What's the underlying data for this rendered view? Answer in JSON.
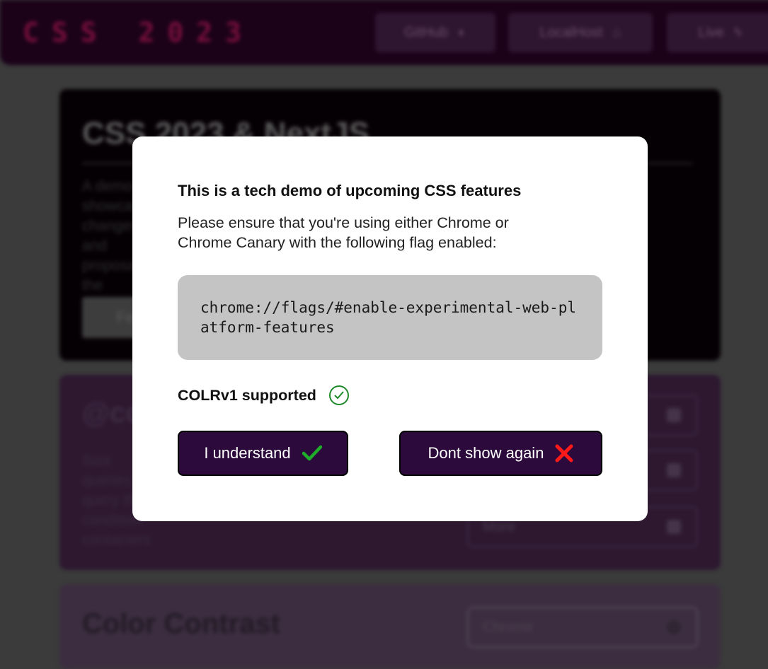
{
  "header": {
    "logo": "CSS 2023",
    "nav": [
      {
        "label": "GitHub",
        "icon": "github-icon"
      },
      {
        "label": "LocalHost",
        "icon": "home-icon"
      },
      {
        "label": "Live",
        "icon": "lightning-icon"
      }
    ]
  },
  "hero": {
    "title": "CSS 2023 & NextJS",
    "text": "A demo showcasing changes and proposals to the \"upcoming\" enabled",
    "button_label": "Fe"
  },
  "sections": [
    {
      "title": "@co",
      "text": "Size queries to query the condition containers",
      "selects": [
        "",
        "",
        "More"
      ]
    },
    {
      "title": "Color Contrast",
      "selects": [
        "Chrome"
      ]
    }
  ],
  "modal": {
    "title": "This is a tech demo of upcoming CSS features",
    "body": "Please ensure that you're using either Chrome or Chrome Canary with the following flag enabled:",
    "flag": "chrome://flags/#enable-experimental-web-platform-features",
    "support_label": "COLRv1 supported",
    "support_icon": "check-circle-icon",
    "understand_label": "I understand",
    "dont_show_label": "Dont show again"
  },
  "colors": {
    "button_bg": "#2c0a3c",
    "success": "#1e8a2c",
    "danger": "#ff0000",
    "codebox_bg": "#c4c4c4"
  }
}
